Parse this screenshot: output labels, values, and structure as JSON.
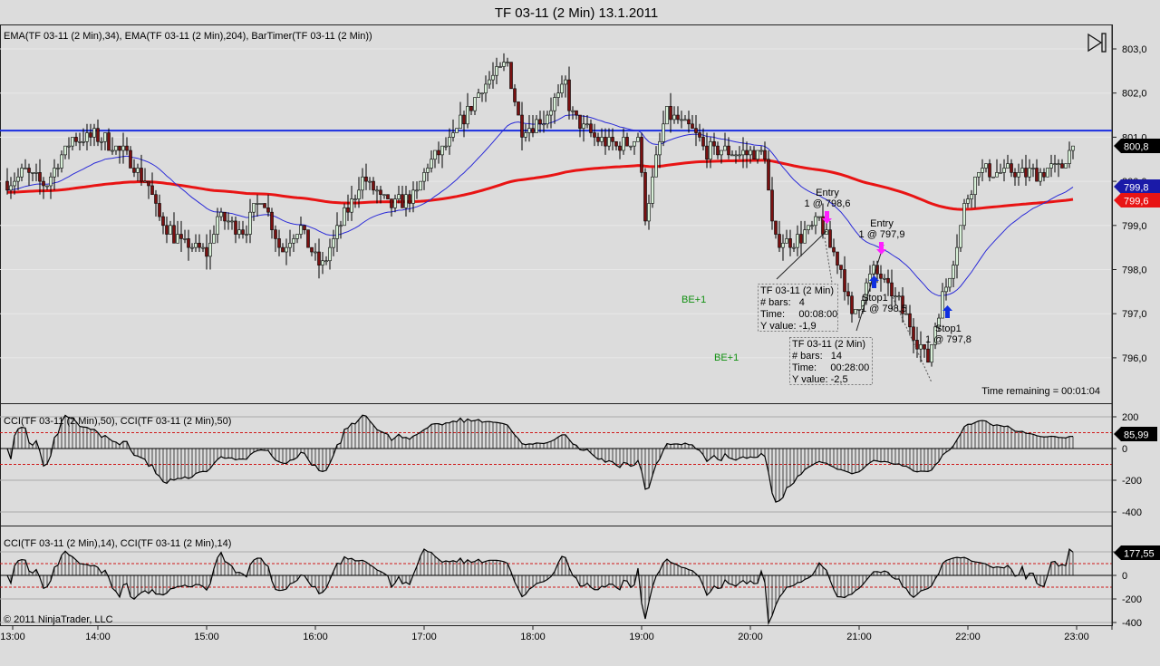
{
  "window": {
    "title": "TF 03-11 (2 Min)  13.1.2011",
    "copyright": "© 2011 NinjaTrader, LLC",
    "timer_text": "Time remaining = 00:01:04"
  },
  "panels": {
    "price_label": "EMA(TF 03-11 (2 Min),34), EMA(TF 03-11 (2 Min),204), BarTimer(TF 03-11 (2 Min))",
    "cci50_label": "CCI(TF 03-11 (2 Min),50), CCI(TF 03-11 (2 Min),50)",
    "cci14_label": "CCI(TF 03-11 (2 Min),14), CCI(TF 03-11 (2 Min),14)"
  },
  "tags": {
    "last_price": "800,8",
    "ema34": "799,8",
    "ema204": "799,6",
    "cci50": "85,99",
    "cci14": "177,55"
  },
  "colors": {
    "ema34": "#2a2ad8",
    "ema204": "#e81414",
    "hline": "#1a2ee0",
    "up": "#d8f0d8",
    "down": "#7a1010",
    "dash": "#d01818",
    "marker_entry": "#ff20ff",
    "marker_stop": "#1030e0",
    "be": "#109010"
  },
  "chart_data": {
    "type": "candlestick",
    "title": "TF 03-11 (2 Min)  13.1.2011",
    "bar_minutes": 2,
    "x_ticks": [
      "13:00",
      "14:00",
      "15:00",
      "16:00",
      "17:00",
      "18:00",
      "19:00",
      "20:00",
      "21:00",
      "22:00",
      "23:00"
    ],
    "price_ticks": [
      "803,0",
      "802,0",
      "801,0",
      "800,0",
      "799,0",
      "798,0",
      "797,0",
      "796,0"
    ],
    "price_range": [
      795.2,
      803.3
    ],
    "horizontal_line": 801.15,
    "price_path_minutes_since_1300": [
      [
        11,
        800.0
      ],
      [
        21,
        800.2
      ],
      [
        31,
        799.9
      ],
      [
        46,
        801.0
      ],
      [
        61,
        801.0
      ],
      [
        76,
        800.6
      ],
      [
        88,
        799.9
      ],
      [
        93,
        799.2
      ],
      [
        106,
        798.6
      ],
      [
        121,
        798.4
      ],
      [
        126,
        799.2
      ],
      [
        141,
        798.9
      ],
      [
        151,
        799.7
      ],
      [
        161,
        798.4
      ],
      [
        171,
        799.0
      ],
      [
        183,
        798.0
      ],
      [
        196,
        799.2
      ],
      [
        206,
        800.1
      ],
      [
        221,
        799.4
      ],
      [
        236,
        799.7
      ],
      [
        241,
        800.3
      ],
      [
        256,
        801.0
      ],
      [
        271,
        802.1
      ],
      [
        286,
        802.7
      ],
      [
        293,
        801.2
      ],
      [
        306,
        801.4
      ],
      [
        318,
        802.2
      ],
      [
        321,
        801.5
      ],
      [
        336,
        800.9
      ],
      [
        346,
        800.8
      ],
      [
        358,
        801.0
      ],
      [
        362,
        799.2
      ],
      [
        366,
        800.0
      ],
      [
        373,
        801.5
      ],
      [
        386,
        801.2
      ],
      [
        396,
        800.7
      ],
      [
        428,
        800.6
      ],
      [
        433,
        798.6
      ],
      [
        446,
        798.7
      ],
      [
        458,
        799.1
      ],
      [
        471,
        797.9
      ],
      [
        476,
        796.9
      ],
      [
        488,
        798.0
      ],
      [
        501,
        797.3
      ],
      [
        511,
        796.5
      ],
      [
        518,
        795.9
      ],
      [
        523,
        796.9
      ],
      [
        531,
        798.1
      ],
      [
        538,
        799.4
      ],
      [
        546,
        800.3
      ],
      [
        556,
        800.2
      ],
      [
        576,
        800.2
      ],
      [
        591,
        800.3
      ],
      [
        598,
        800.8
      ]
    ],
    "ema_periods": [
      34,
      204
    ],
    "cci_ticks_50": [
      "200",
      "0",
      "-200",
      "-400"
    ],
    "cci_ticks_14": [
      "200",
      "0",
      "-200",
      "-400"
    ],
    "cci_range": [
      -450,
      250
    ],
    "last_values": {
      "close": 800.8,
      "ema34": 799.8,
      "ema204": 799.6,
      "cci50": 85.99,
      "cci14": 177.55
    }
  },
  "annotations": {
    "entry1": {
      "title": "Entry",
      "detail": "1 @ 798,6"
    },
    "entry2": {
      "title": "Entry",
      "detail": "1 @ 797,9"
    },
    "stop1": {
      "title": "Stop1",
      "detail": "1 @ 798,5"
    },
    "stop2": {
      "title": "Stop1",
      "detail": "1 @ 797,8"
    },
    "be1": "BE+1",
    "be2": "BE+1",
    "box1": {
      "title": "TF 03-11 (2 Min)",
      "bars": "# bars:   4",
      "time": "Time:     00:08:00",
      "y": "Y value: -1,9"
    },
    "box2": {
      "title": "TF 03-11 (2 Min)",
      "bars": "# bars:   14",
      "time": "Time:     00:28:00",
      "y": "Y value: -2,5"
    }
  }
}
